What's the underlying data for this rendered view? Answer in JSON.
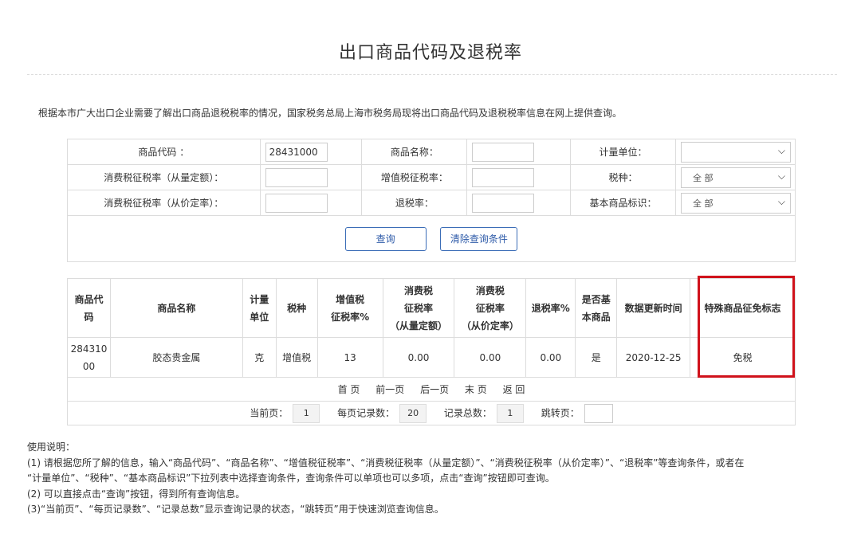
{
  "page": {
    "title": "出口商品代码及退税率",
    "intro": "根据本市广大出口企业需要了解出口商品退税税率的情况，国家税务总局上海市税务局现将出口商品代码及退税税率信息在网上提供查询。"
  },
  "search": {
    "labels": {
      "code": "商品代码 ：",
      "name": "商品名称：",
      "unit": "计量单位：",
      "consumption_quantity": "消费税征税率（从量定额）：",
      "vat": "增值税征税率：",
      "tax_type": "税种：",
      "consumption_value": "消费税征税率（从价定率）：",
      "refund": "退税率：",
      "basic_flag": "基本商品标识："
    },
    "values": {
      "code": "28431000",
      "name": "",
      "consumption_quantity": "",
      "vat": "",
      "consumption_value": "",
      "refund": ""
    },
    "selects": {
      "unit": "",
      "tax_type": "全 部",
      "basic_flag": "全 部"
    },
    "buttons": {
      "query": "查询",
      "clear": "清除查询条件"
    }
  },
  "results": {
    "headers": {
      "code": [
        "商品代",
        "码"
      ],
      "name": "商品名称",
      "unit": [
        "计量",
        "单位"
      ],
      "tax_type": "税种",
      "vat": [
        "增值税",
        "征税率%"
      ],
      "cq": [
        "消费税",
        "征税率",
        "（从量定额）"
      ],
      "cv": [
        "消费税",
        "征税率",
        "（从价定率）"
      ],
      "refund": "退税率%",
      "basic": [
        "是否基",
        "本商品"
      ],
      "updated": "数据更新时间",
      "special": "特殊商品征免标志"
    },
    "rows": [
      {
        "code": [
          "284310",
          "00"
        ],
        "name": "胶态贵金属",
        "unit": "克",
        "tax_type": "增值税",
        "vat": "13",
        "cq": "0.00",
        "cv": "0.00",
        "refund": "0.00",
        "basic": "是",
        "updated": "2020-12-25",
        "special": "免税"
      }
    ]
  },
  "pager": {
    "first": "首 页",
    "prev": "前一页",
    "next": "后一页",
    "last": "末 页",
    "back": "返 回",
    "current_label": "当前页：",
    "current": "1",
    "per_page_label": "每页记录数：",
    "per_page": "20",
    "total_label": "记录总数：",
    "total": "1",
    "jump_label": "跳转页："
  },
  "notes": [
    "使用说明：",
    "(1) 请根据您所了解的信息，输入“商品代码”、“商品名称”、“增值税征税率”、“消费税征税率（从量定额）”、“消费税征税率（从价定率）”、“退税率”等查询条件，或者在",
    "“计量单位”、“税种”、“基本商品标识”下拉列表中选择查询条件，查询条件可以单项也可以多项，点击“查询”按钮即可查询。",
    "(2) 可以直接点击“查询”按钮，得到所有查询信息。",
    "(3)“当前页”、“每页记录数”、“记录总数”显示查询记录的状态，“跳转页”用于快速浏览查询信息。"
  ],
  "colors": {
    "highlight": "#d0121b",
    "button_border": "#3b6db7"
  }
}
